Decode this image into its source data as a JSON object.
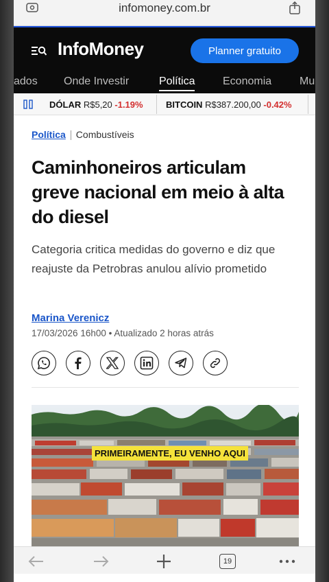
{
  "browser": {
    "url": "infomoney.com.br",
    "tab_count": "19"
  },
  "header": {
    "logo": "InfoMoney",
    "planner_button": "Planner gratuito"
  },
  "nav": {
    "items": [
      "ados",
      "Onde Investir",
      "Política",
      "Economia",
      "Mu"
    ],
    "active": "Política"
  },
  "ticker": [
    {
      "name": "DÓLAR",
      "value": "R$5,20",
      "change": "-1.19%"
    },
    {
      "name": "BITCOIN",
      "value": "R$387.200,00",
      "change": "-0.42%"
    }
  ],
  "article": {
    "category": "Política",
    "subcategory": "Combustíveis",
    "title": "Caminhoneiros articulam greve nacional em meio à alta do diesel",
    "subtitle": "Categoria critica medidas do governo e diz que reajuste da Petrobras anulou alívio prometido",
    "author": "Marina Verenicz",
    "meta": "17/03/2026 16h00 • Atualizado 2 horas atrás",
    "share_icons": [
      "whatsapp-icon",
      "facebook-icon",
      "x-icon",
      "linkedin-icon",
      "telegram-icon",
      "link-icon"
    ],
    "video_caption": "PRIMEIRAMENTE, EU VENHO AQUI"
  },
  "colors": {
    "accent": "#1a73e8",
    "link": "#1a56c9",
    "negative": "#d32f2f",
    "header_bg": "#0b0b0b"
  }
}
